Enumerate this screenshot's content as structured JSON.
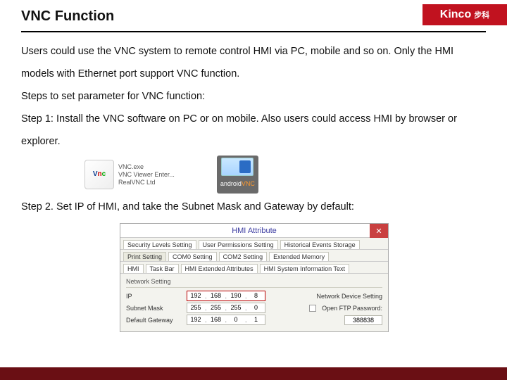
{
  "header": {
    "title": "VNC Function",
    "brand": "Kinco",
    "brand_cn": "步科"
  },
  "text": {
    "p1": "Users could use the VNC system to remote control HMI via PC, mobile and so on.  Only the HMI models with Ethernet port support VNC function.",
    "p2": "Steps to set parameter for VNC function:",
    "p3": "Step 1: Install the VNC software on PC or on mobile. Also users could access HMI by browser or explorer.",
    "p4": "Step 2. Set IP of HMI, and take the Subnet Mask and Gateway by default:"
  },
  "icons": {
    "win": {
      "line1": "VNC.exe",
      "line2": "VNC Viewer Enter...",
      "line3": "RealVNC Ltd"
    },
    "android": {
      "label_prefix": "android",
      "label_suffix": "VNC"
    }
  },
  "dialog": {
    "title": "HMI Attribute",
    "tabs_row1": [
      "Security Levels Setting",
      "User Permissions Setting",
      "Historical Events Storage"
    ],
    "tabs_row2": [
      "Print Setting",
      "COM0 Setting",
      "COM2 Setting",
      "Extended Memory"
    ],
    "tabs_row3": [
      "HMI",
      "Task Bar",
      "HMI Extended Attributes",
      "HMI System Information Text"
    ],
    "group": "Network Setting",
    "rows": {
      "ip": {
        "label": "IP",
        "oct": [
          "192",
          "168",
          "190",
          "8"
        ],
        "right": "Network Device Setting"
      },
      "mask": {
        "label": "Subnet Mask",
        "oct": [
          "255",
          "255",
          "255",
          "0"
        ],
        "chk_label": "Open FTP Password:"
      },
      "gateway": {
        "label": "Default Gateway",
        "oct": [
          "192",
          "168",
          "0",
          "1"
        ],
        "port": "388838"
      }
    }
  }
}
